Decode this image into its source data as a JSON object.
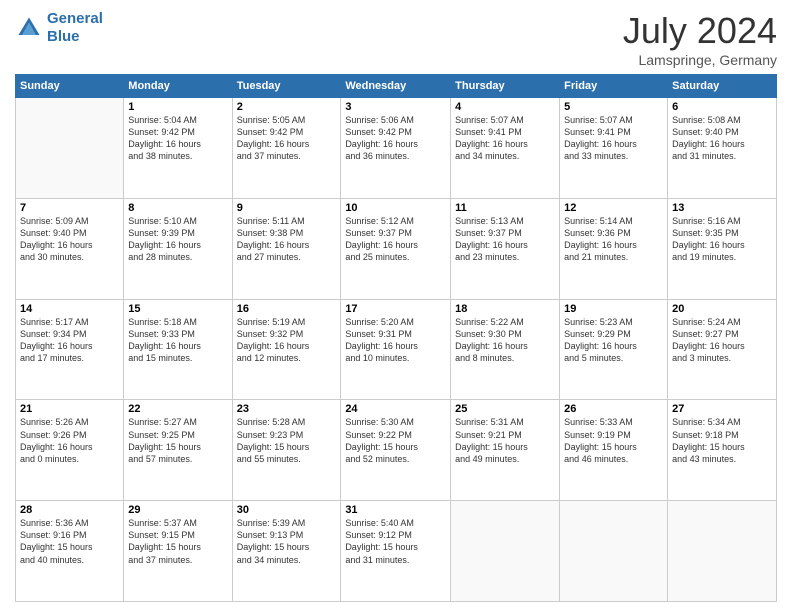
{
  "header": {
    "logo_line1": "General",
    "logo_line2": "Blue",
    "month": "July 2024",
    "location": "Lamspringe, Germany"
  },
  "weekdays": [
    "Sunday",
    "Monday",
    "Tuesday",
    "Wednesday",
    "Thursday",
    "Friday",
    "Saturday"
  ],
  "weeks": [
    [
      {
        "day": "",
        "info": ""
      },
      {
        "day": "1",
        "info": "Sunrise: 5:04 AM\nSunset: 9:42 PM\nDaylight: 16 hours\nand 38 minutes."
      },
      {
        "day": "2",
        "info": "Sunrise: 5:05 AM\nSunset: 9:42 PM\nDaylight: 16 hours\nand 37 minutes."
      },
      {
        "day": "3",
        "info": "Sunrise: 5:06 AM\nSunset: 9:42 PM\nDaylight: 16 hours\nand 36 minutes."
      },
      {
        "day": "4",
        "info": "Sunrise: 5:07 AM\nSunset: 9:41 PM\nDaylight: 16 hours\nand 34 minutes."
      },
      {
        "day": "5",
        "info": "Sunrise: 5:07 AM\nSunset: 9:41 PM\nDaylight: 16 hours\nand 33 minutes."
      },
      {
        "day": "6",
        "info": "Sunrise: 5:08 AM\nSunset: 9:40 PM\nDaylight: 16 hours\nand 31 minutes."
      }
    ],
    [
      {
        "day": "7",
        "info": "Sunrise: 5:09 AM\nSunset: 9:40 PM\nDaylight: 16 hours\nand 30 minutes."
      },
      {
        "day": "8",
        "info": "Sunrise: 5:10 AM\nSunset: 9:39 PM\nDaylight: 16 hours\nand 28 minutes."
      },
      {
        "day": "9",
        "info": "Sunrise: 5:11 AM\nSunset: 9:38 PM\nDaylight: 16 hours\nand 27 minutes."
      },
      {
        "day": "10",
        "info": "Sunrise: 5:12 AM\nSunset: 9:37 PM\nDaylight: 16 hours\nand 25 minutes."
      },
      {
        "day": "11",
        "info": "Sunrise: 5:13 AM\nSunset: 9:37 PM\nDaylight: 16 hours\nand 23 minutes."
      },
      {
        "day": "12",
        "info": "Sunrise: 5:14 AM\nSunset: 9:36 PM\nDaylight: 16 hours\nand 21 minutes."
      },
      {
        "day": "13",
        "info": "Sunrise: 5:16 AM\nSunset: 9:35 PM\nDaylight: 16 hours\nand 19 minutes."
      }
    ],
    [
      {
        "day": "14",
        "info": "Sunrise: 5:17 AM\nSunset: 9:34 PM\nDaylight: 16 hours\nand 17 minutes."
      },
      {
        "day": "15",
        "info": "Sunrise: 5:18 AM\nSunset: 9:33 PM\nDaylight: 16 hours\nand 15 minutes."
      },
      {
        "day": "16",
        "info": "Sunrise: 5:19 AM\nSunset: 9:32 PM\nDaylight: 16 hours\nand 12 minutes."
      },
      {
        "day": "17",
        "info": "Sunrise: 5:20 AM\nSunset: 9:31 PM\nDaylight: 16 hours\nand 10 minutes."
      },
      {
        "day": "18",
        "info": "Sunrise: 5:22 AM\nSunset: 9:30 PM\nDaylight: 16 hours\nand 8 minutes."
      },
      {
        "day": "19",
        "info": "Sunrise: 5:23 AM\nSunset: 9:29 PM\nDaylight: 16 hours\nand 5 minutes."
      },
      {
        "day": "20",
        "info": "Sunrise: 5:24 AM\nSunset: 9:27 PM\nDaylight: 16 hours\nand 3 minutes."
      }
    ],
    [
      {
        "day": "21",
        "info": "Sunrise: 5:26 AM\nSunset: 9:26 PM\nDaylight: 16 hours\nand 0 minutes."
      },
      {
        "day": "22",
        "info": "Sunrise: 5:27 AM\nSunset: 9:25 PM\nDaylight: 15 hours\nand 57 minutes."
      },
      {
        "day": "23",
        "info": "Sunrise: 5:28 AM\nSunset: 9:23 PM\nDaylight: 15 hours\nand 55 minutes."
      },
      {
        "day": "24",
        "info": "Sunrise: 5:30 AM\nSunset: 9:22 PM\nDaylight: 15 hours\nand 52 minutes."
      },
      {
        "day": "25",
        "info": "Sunrise: 5:31 AM\nSunset: 9:21 PM\nDaylight: 15 hours\nand 49 minutes."
      },
      {
        "day": "26",
        "info": "Sunrise: 5:33 AM\nSunset: 9:19 PM\nDaylight: 15 hours\nand 46 minutes."
      },
      {
        "day": "27",
        "info": "Sunrise: 5:34 AM\nSunset: 9:18 PM\nDaylight: 15 hours\nand 43 minutes."
      }
    ],
    [
      {
        "day": "28",
        "info": "Sunrise: 5:36 AM\nSunset: 9:16 PM\nDaylight: 15 hours\nand 40 minutes."
      },
      {
        "day": "29",
        "info": "Sunrise: 5:37 AM\nSunset: 9:15 PM\nDaylight: 15 hours\nand 37 minutes."
      },
      {
        "day": "30",
        "info": "Sunrise: 5:39 AM\nSunset: 9:13 PM\nDaylight: 15 hours\nand 34 minutes."
      },
      {
        "day": "31",
        "info": "Sunrise: 5:40 AM\nSunset: 9:12 PM\nDaylight: 15 hours\nand 31 minutes."
      },
      {
        "day": "",
        "info": ""
      },
      {
        "day": "",
        "info": ""
      },
      {
        "day": "",
        "info": ""
      }
    ]
  ]
}
